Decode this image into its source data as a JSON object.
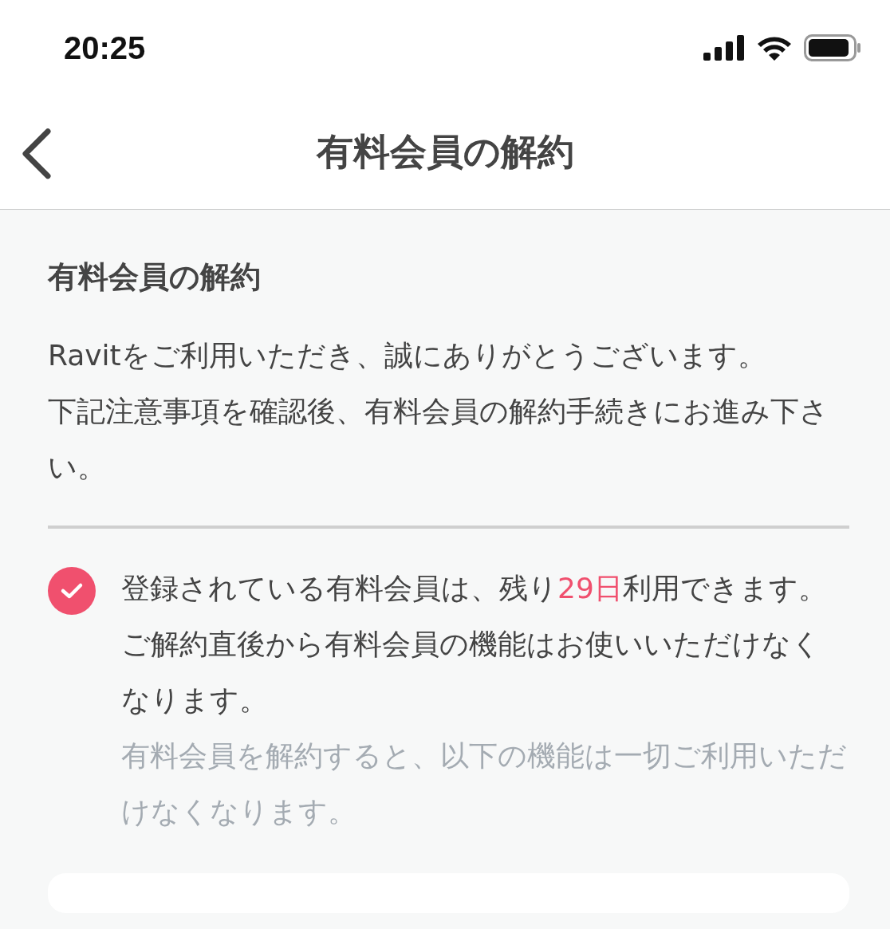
{
  "status_bar": {
    "time": "20:25"
  },
  "nav": {
    "title": "有料会員の解約"
  },
  "section": {
    "title": "有料会員の解約",
    "paragraphs": [
      "Ravitをご利用いただき、誠にありがとうございます。",
      "下記注意事項を確認後、有料会員の解約手続きにお進み下さい。"
    ]
  },
  "notice": {
    "checked": true,
    "lines": [
      {
        "kind": "main",
        "parts": [
          {
            "text": "登録されている有料会員は、残り",
            "highlight": false
          },
          {
            "text": "29日",
            "highlight": true
          },
          {
            "text": "利用できます。",
            "highlight": false
          }
        ]
      },
      {
        "kind": "main",
        "parts": [
          {
            "text": "ご解約直後から有料会員の機能はお使いいただけなくなります。",
            "highlight": false
          }
        ]
      },
      {
        "kind": "note",
        "parts": [
          {
            "text": "有料会員を解約すると、以下の機能は一切ご利用いただけなくなります。",
            "highlight": false
          }
        ]
      }
    ]
  }
}
